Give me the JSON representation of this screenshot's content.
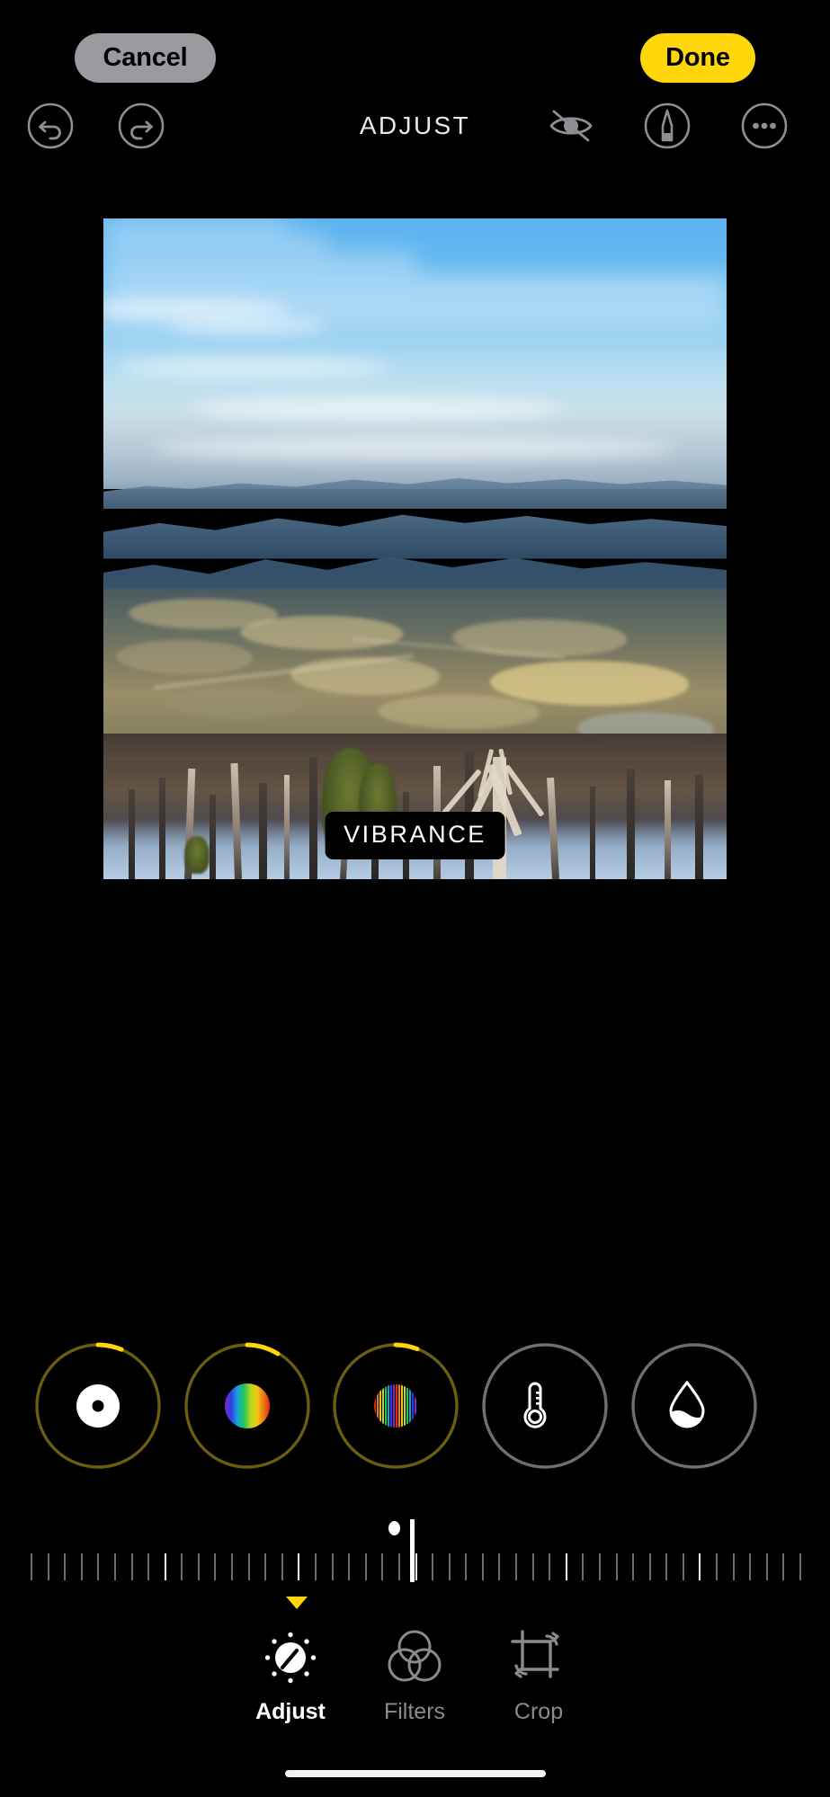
{
  "screen": {
    "title": "ADJUST",
    "background": "#000000"
  },
  "topbar": {
    "cancel_label": "Cancel",
    "done_label": "Done",
    "cancel_bg": "#9a9a9f",
    "done_bg": "#ffd60a"
  },
  "toolrow": {
    "title": "ADJUST",
    "icons": [
      {
        "name": "undo-icon",
        "label": "Undo"
      },
      {
        "name": "redo-icon",
        "label": "Redo"
      },
      {
        "name": "eye-slash-icon",
        "label": "Hide Edits"
      },
      {
        "name": "markup-pen-icon",
        "label": "Markup"
      },
      {
        "name": "more-ellipsis-icon",
        "label": "More"
      }
    ]
  },
  "photo": {
    "overlay_label": "VIBRANCE",
    "alt": "Winter mountain overlook with blue sky, distant ridges, farm fields and bare snowy trees"
  },
  "adjust_dials": [
    {
      "id": "exposure",
      "icon": "donut-icon",
      "label": "Exposure",
      "active": true,
      "ring_color": "#6b5d10",
      "arc_color": "#ffd60a",
      "arc_value": 8
    },
    {
      "id": "vibrance",
      "icon": "spectrum-icon",
      "label": "Vibrance",
      "active": true,
      "ring_color": "#6b5d10",
      "arc_color": "#ffd60a",
      "arc_value": 12
    },
    {
      "id": "saturation",
      "icon": "color-bars-icon",
      "label": "Saturation",
      "active": true,
      "ring_color": "#6b5d10",
      "arc_color": "#ffd60a",
      "arc_value": 7
    },
    {
      "id": "warmth",
      "icon": "thermometer-icon",
      "label": "Warmth",
      "active": false,
      "ring_color": "#6e6e73",
      "arc_color": "#6e6e73",
      "arc_value": 0
    },
    {
      "id": "tint",
      "icon": "droplet-icon",
      "label": "Tint",
      "active": false,
      "ring_color": "#6e6e73",
      "arc_color": "#6e6e73",
      "arc_value": 0
    }
  ],
  "slider": {
    "selected_adjustment": "VIBRANCE",
    "value_marker_position_pct": 49.4,
    "zero_dot_position_pct": 46.8,
    "tick_count": 47,
    "major_tick_indices": [
      8,
      16,
      23,
      32,
      40
    ]
  },
  "tabs": [
    {
      "id": "adjust",
      "label": "Adjust",
      "icon": "adjust-dial-icon",
      "active": true
    },
    {
      "id": "filters",
      "label": "Filters",
      "icon": "filters-circles-icon",
      "active": false
    },
    {
      "id": "crop",
      "label": "Crop",
      "icon": "crop-rotate-icon",
      "active": false
    }
  ],
  "home_indicator": {
    "visible": true
  }
}
